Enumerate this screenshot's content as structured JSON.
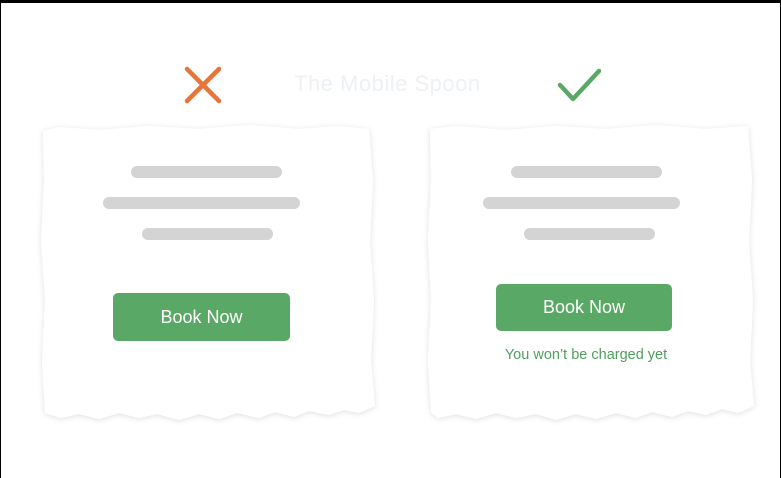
{
  "watermark": "The Mobile Spoon",
  "colors": {
    "bad_mark": "#e8743a",
    "good_mark": "#5aa865",
    "button": "#5aa865",
    "button_text": "#ffffff",
    "note_text": "#4f9f5b",
    "placeholder_line": "#d4d4d4"
  },
  "bad_example": {
    "mark_icon": "cross-icon",
    "button_label": "Book Now"
  },
  "good_example": {
    "mark_icon": "checkmark-icon",
    "button_label": "Book Now",
    "note": "You won’t be charged yet"
  }
}
